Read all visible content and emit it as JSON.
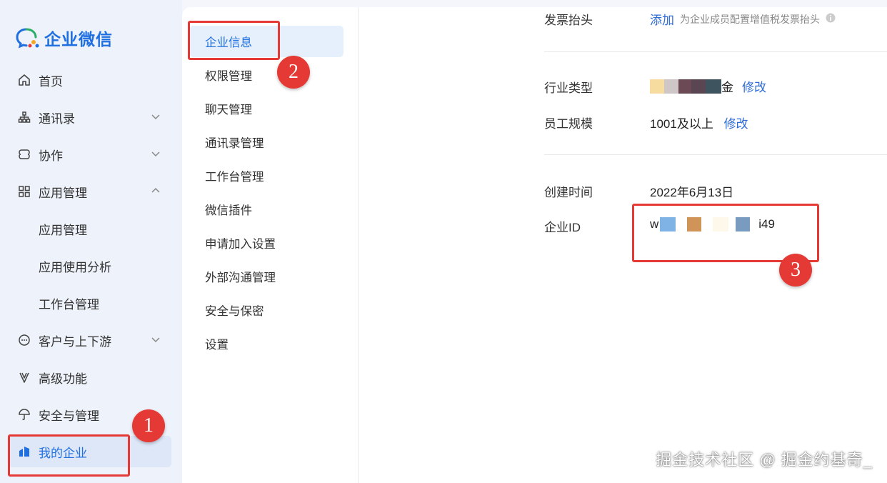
{
  "app": {
    "logo_text": "企业微信"
  },
  "sidebar": {
    "items": [
      {
        "label": "首页",
        "icon": "home-icon"
      },
      {
        "label": "通讯录",
        "icon": "org-icon"
      },
      {
        "label": "协作",
        "icon": "collab-icon"
      },
      {
        "label": "应用管理",
        "icon": "grid-icon"
      },
      {
        "label": "应用管理"
      },
      {
        "label": "应用使用分析"
      },
      {
        "label": "工作台管理"
      },
      {
        "label": "客户与上下游",
        "icon": "chat-icon"
      },
      {
        "label": "高级功能",
        "icon": "advanced-icon"
      },
      {
        "label": "安全与管理",
        "icon": "umbrella-icon"
      },
      {
        "label": "我的企业",
        "icon": "company-icon"
      }
    ]
  },
  "settings_menu": {
    "items": [
      "企业信息",
      "权限管理",
      "聊天管理",
      "通讯录管理",
      "工作台管理",
      "微信插件",
      "申请加入设置",
      "外部沟通管理",
      "安全与保密",
      "设置"
    ]
  },
  "company_info": {
    "invoice_label": "发票抬头",
    "invoice_action": "添加",
    "invoice_hint": "为企业成员配置增值税发票抬头",
    "industry_label": "行业类型",
    "industry_value_suffix": "金",
    "industry_edit": "修改",
    "scale_label": "员工规模",
    "scale_value": "1001及以上",
    "scale_edit": "修改",
    "created_label": "创建时间",
    "created_value": "2022年6月13日",
    "corpid_label": "企业ID",
    "corpid_prefix": "w",
    "corpid_suffix": "i49"
  },
  "annotations": {
    "step1": "1",
    "step2": "2",
    "step3": "3"
  },
  "watermark": "掘金技术社区 @ 掘金约基奇_",
  "colors": {
    "accent": "#1f6fe0",
    "link": "#2d6bd6",
    "annotation_red": "#e53935"
  }
}
